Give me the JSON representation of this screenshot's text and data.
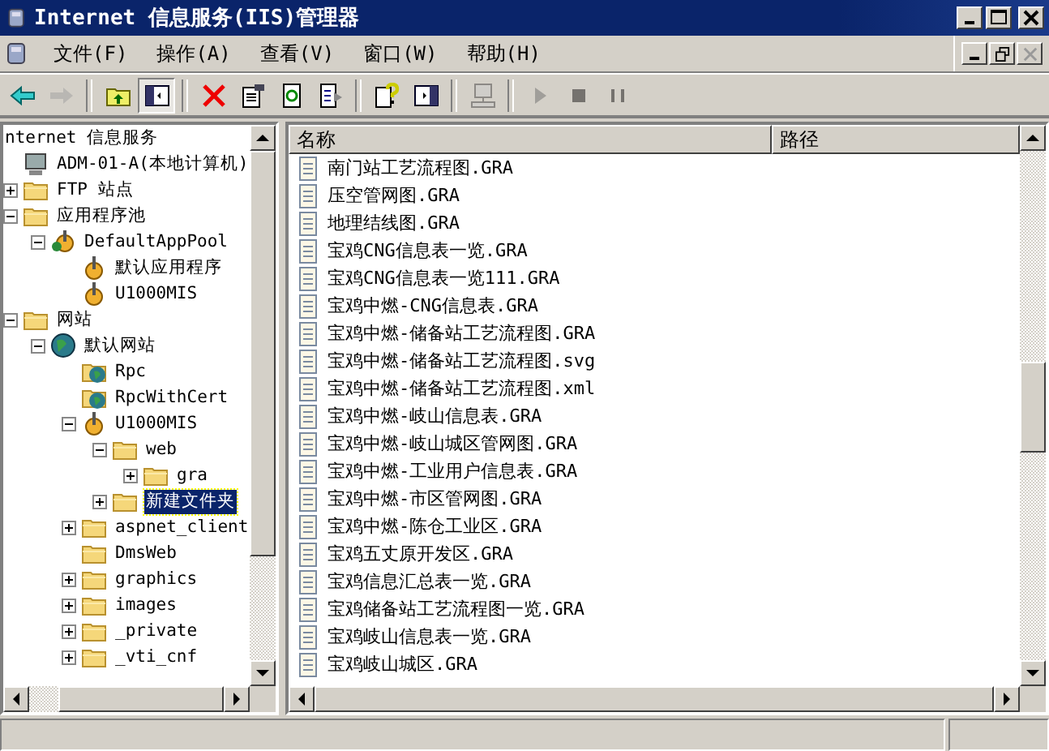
{
  "window": {
    "title": "Internet 信息服务(IIS)管理器"
  },
  "menu": [
    "文件(F)",
    "操作(A)",
    "查看(V)",
    "窗口(W)",
    "帮助(H)"
  ],
  "toolbar": [
    [
      {
        "kind": "back",
        "disabled": false
      },
      {
        "kind": "forward",
        "disabled": true
      }
    ],
    [
      {
        "kind": "up",
        "disabled": false
      },
      {
        "kind": "tree",
        "disabled": false,
        "pressed": true
      }
    ],
    [
      {
        "kind": "delete",
        "disabled": false
      },
      {
        "kind": "properties",
        "disabled": false
      },
      {
        "kind": "refresh",
        "disabled": false
      },
      {
        "kind": "export",
        "disabled": false
      }
    ],
    [
      {
        "kind": "help",
        "disabled": false
      },
      {
        "kind": "pane",
        "disabled": false
      }
    ],
    [
      {
        "kind": "computer",
        "disabled": true
      }
    ],
    [
      {
        "kind": "play",
        "disabled": true
      },
      {
        "kind": "stop",
        "disabled": true
      },
      {
        "kind": "pause",
        "disabled": true
      }
    ]
  ],
  "tree": [
    {
      "label": "nternet 信息服务",
      "selected": false,
      "children": [
        {
          "label": "ADM-01-A(本地计算机)",
          "kind": "computer",
          "selected": false,
          "children": [
            {
              "label": "FTP 站点",
              "kind": "folder",
              "expanded": false,
              "selected": false
            },
            {
              "label": "应用程序池",
              "kind": "folder",
              "expanded": true,
              "selected": false,
              "children": [
                {
                  "label": "DefaultAppPool",
                  "kind": "pool",
                  "expanded": true,
                  "selected": false,
                  "children": [
                    {
                      "label": "默认应用程序",
                      "kind": "gear",
                      "selected": false
                    },
                    {
                      "label": "U1000MIS",
                      "kind": "gear",
                      "selected": false
                    }
                  ]
                }
              ]
            },
            {
              "label": "网站",
              "kind": "folder",
              "expanded": true,
              "selected": false,
              "children": [
                {
                  "label": "默认网站",
                  "kind": "globe",
                  "expanded": true,
                  "selected": false,
                  "children": [
                    {
                      "label": "Rpc",
                      "kind": "webfolder",
                      "selected": false
                    },
                    {
                      "label": "RpcWithCert",
                      "kind": "webfolder",
                      "selected": false
                    },
                    {
                      "label": "U1000MIS",
                      "kind": "gear",
                      "expanded": true,
                      "selected": false,
                      "children": [
                        {
                          "label": "web",
                          "kind": "folder",
                          "expanded": true,
                          "selected": false,
                          "children": [
                            {
                              "label": "gra",
                              "kind": "folder",
                              "expanded": false,
                              "selected": false
                            }
                          ]
                        },
                        {
                          "label": "新建文件夹",
                          "kind": "folder",
                          "expanded": false,
                          "selected": true
                        }
                      ]
                    },
                    {
                      "label": "aspnet_client",
                      "kind": "folder",
                      "expanded": false,
                      "selected": false
                    },
                    {
                      "label": "DmsWeb",
                      "kind": "folder",
                      "selected": false
                    },
                    {
                      "label": "graphics",
                      "kind": "folder",
                      "expanded": false,
                      "selected": false
                    },
                    {
                      "label": "images",
                      "kind": "folder",
                      "expanded": false,
                      "selected": false
                    },
                    {
                      "label": "_private",
                      "kind": "folder",
                      "expanded": false,
                      "selected": false
                    },
                    {
                      "label": "_vti_cnf",
                      "kind": "folder",
                      "expanded": false,
                      "selected": false
                    }
                  ]
                }
              ]
            }
          ]
        }
      ]
    }
  ],
  "list": {
    "columns": [
      "名称",
      "路径"
    ],
    "rows": [
      "南门站工艺流程图.GRA",
      "压空管网图.GRA",
      "地理结线图.GRA",
      "宝鸡CNG信息表一览.GRA",
      "宝鸡CNG信息表一览111.GRA",
      "宝鸡中燃-CNG信息表.GRA",
      "宝鸡中燃-储备站工艺流程图.GRA",
      "宝鸡中燃-储备站工艺流程图.svg",
      "宝鸡中燃-储备站工艺流程图.xml",
      "宝鸡中燃-岐山信息表.GRA",
      "宝鸡中燃-岐山城区管网图.GRA",
      "宝鸡中燃-工业用户信息表.GRA",
      "宝鸡中燃-市区管网图.GRA",
      "宝鸡中燃-陈仓工业区.GRA",
      "宝鸡五丈原开发区.GRA",
      "宝鸡信息汇总表一览.GRA",
      "宝鸡储备站工艺流程图一览.GRA",
      "宝鸡岐山信息表一览.GRA",
      "宝鸡岐山城区.GRA"
    ]
  }
}
